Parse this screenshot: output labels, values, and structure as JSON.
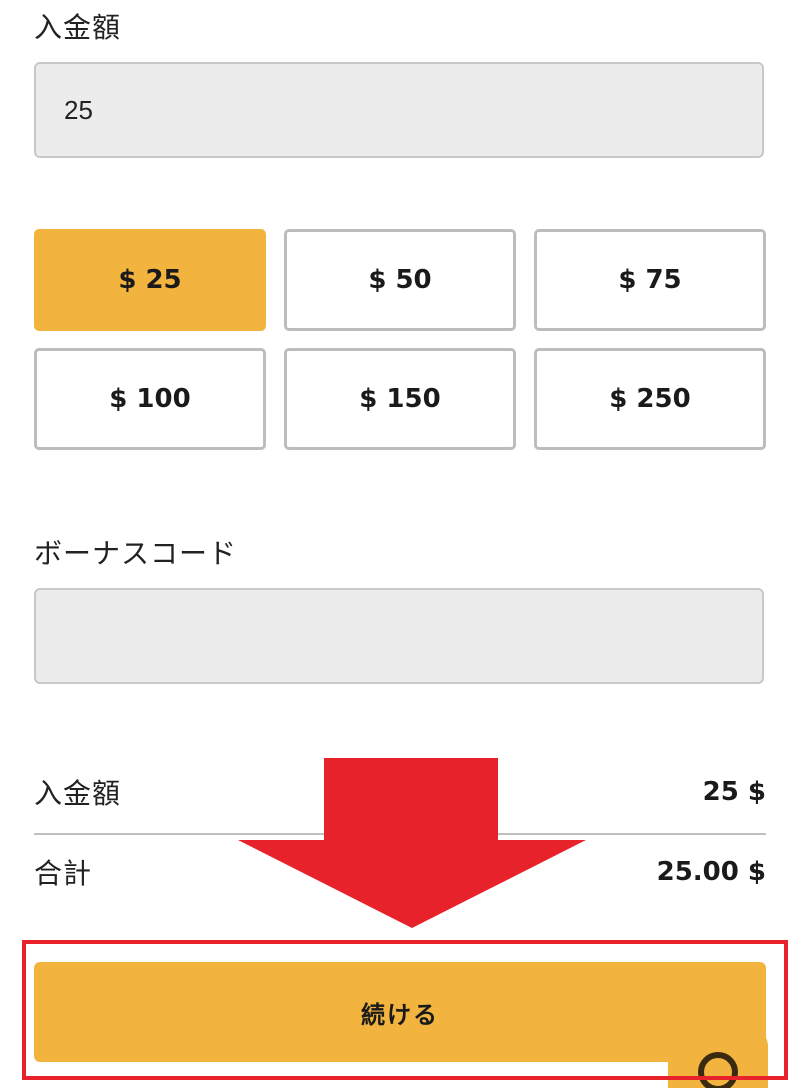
{
  "deposit": {
    "label": "入金額",
    "value": "25",
    "placeholder": ""
  },
  "quick_amounts": [
    {
      "label": "$ 25",
      "selected": true
    },
    {
      "label": "$ 50",
      "selected": false
    },
    {
      "label": "$ 75",
      "selected": false
    },
    {
      "label": "$ 100",
      "selected": false
    },
    {
      "label": "$ 150",
      "selected": false
    },
    {
      "label": "$ 250",
      "selected": false
    }
  ],
  "bonus": {
    "label": "ボーナスコード",
    "value": "",
    "placeholder": ""
  },
  "summary": {
    "deposit_label": "入金額",
    "deposit_value": "25 $",
    "total_label": "合計",
    "total_value": "25.00 $"
  },
  "continue_button": {
    "label": "続ける"
  },
  "annotations": {
    "arrow_color": "#e8222b",
    "highlight_color": "#e8222b"
  },
  "colors": {
    "accent": "#f3b43f",
    "input_bg": "#ececec",
    "border": "#bdbdbd"
  },
  "icons": {
    "chat": "chat-bubble-icon"
  }
}
